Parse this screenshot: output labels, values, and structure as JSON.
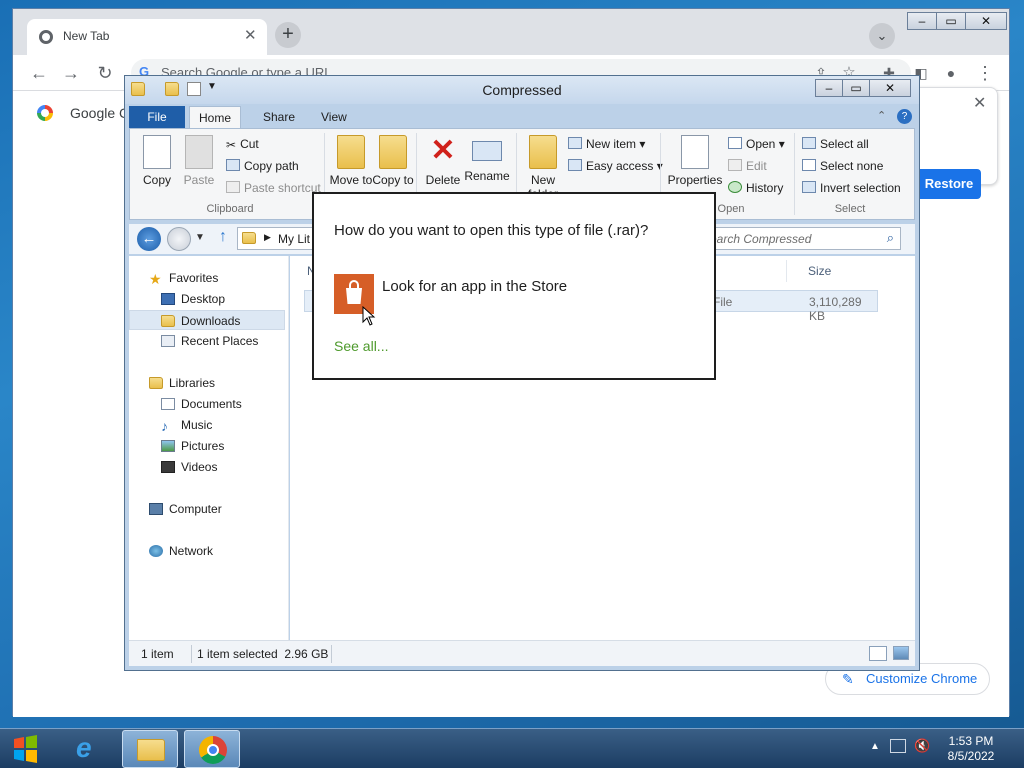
{
  "chrome": {
    "tab_title": "New Tab",
    "omnibox_placeholder": "Search Google or type a URL",
    "bookmark_label": "Google C",
    "restore_label": "Restore",
    "customize_label": "Customize Chrome"
  },
  "explorer": {
    "title": "Compressed",
    "tabs": {
      "file": "File",
      "home": "Home",
      "share": "Share",
      "view": "View"
    },
    "ribbon": {
      "copy": "Copy",
      "paste": "Paste",
      "cut": "Cut",
      "copy_path": "Copy path",
      "paste_shortcut": "Paste shortcut",
      "clipboard_group": "Clipboard",
      "move_to": "Move to",
      "copy_to": "Copy to",
      "delete": "Delete",
      "rename": "Rename",
      "new_folder": "New folder",
      "new_item": "New item",
      "easy_access": "Easy access",
      "properties": "Properties",
      "open": "Open",
      "edit": "Edit",
      "history": "History",
      "open_group": "Open",
      "select_all": "Select all",
      "select_none": "Select none",
      "invert_selection": "Invert selection",
      "select_group": "Select"
    },
    "address_text": "My Lit",
    "search_placeholder": "earch Compressed",
    "nav": {
      "favorites": "Favorites",
      "desktop": "Desktop",
      "downloads": "Downloads",
      "recent_places": "Recent Places",
      "libraries": "Libraries",
      "documents": "Documents",
      "music": "Music",
      "pictures": "Pictures",
      "videos": "Videos",
      "computer": "Computer",
      "network": "Network"
    },
    "columns": {
      "name": "N",
      "size": "Size"
    },
    "file": {
      "type": "File",
      "size": "3,110,289 KB"
    },
    "status": {
      "count": "1 item",
      "selected": "1 item selected  2.96 GB"
    }
  },
  "dialog": {
    "question": "How do you want to open this type of file (.rar)?",
    "store_option": "Look for an app in the Store",
    "see_all": "See all..."
  },
  "taskbar": {
    "time": "1:53 PM",
    "date": "8/5/2022"
  },
  "colors": {
    "accent": "#1a73e8",
    "file_tab": "#1f5ea8",
    "store_tile": "#d65e27",
    "see_all": "#4e9a2c"
  }
}
